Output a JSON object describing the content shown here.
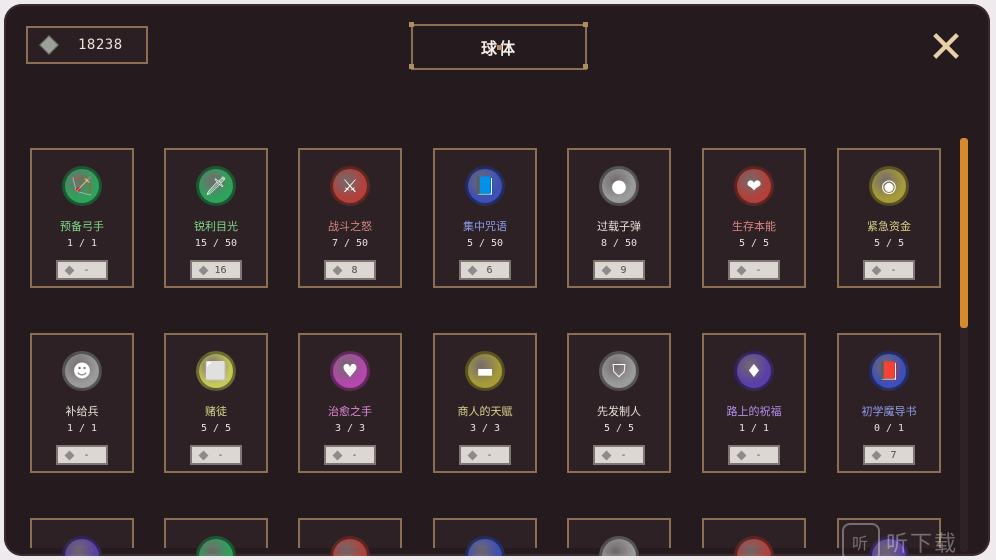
{
  "currency": {
    "icon": "gem-icon",
    "amount": "18238"
  },
  "title": "球体",
  "close_icon": "close-x-icon",
  "cards": [
    {
      "name": "预备弓手",
      "count": "1 / 1",
      "cost": "-",
      "name_color": "#7fd98a",
      "orb_color": "#2fa35c",
      "icon": "bow-icon",
      "glyph": "🏹"
    },
    {
      "name": "锐利目光",
      "count": "15 / 50",
      "cost": "16",
      "name_color": "#7fd98a",
      "orb_color": "#2fa35c",
      "icon": "sword-icon",
      "glyph": "🗡"
    },
    {
      "name": "战斗之怒",
      "count": "7 / 50",
      "cost": "8",
      "name_color": "#d9897f",
      "orb_color": "#b3403a",
      "icon": "sword-icon",
      "glyph": "⚔"
    },
    {
      "name": "集中咒语",
      "count": "5 / 50",
      "cost": "6",
      "name_color": "#8f9bea",
      "orb_color": "#3d4fb8",
      "icon": "tome-icon",
      "glyph": "📘"
    },
    {
      "name": "过载子弹",
      "count": "8 / 50",
      "cost": "9",
      "name_color": "#e6e0da",
      "orb_color": "#9b9b9b",
      "icon": "bullets-icon",
      "glyph": "●"
    },
    {
      "name": "生存本能",
      "count": "5 / 5",
      "cost": "-",
      "name_color": "#d9897f",
      "orb_color": "#b3403a",
      "icon": "heart-icon",
      "glyph": "❤"
    },
    {
      "name": "紧急资金",
      "count": "5 / 5",
      "cost": "-",
      "name_color": "#d9d08a",
      "orb_color": "#a79a3a",
      "icon": "coin-icon",
      "glyph": "◉"
    },
    {
      "name": "补给兵",
      "count": "1 / 1",
      "cost": "-",
      "name_color": "#e6e0da",
      "orb_color": "#9b9b9b",
      "icon": "soldier-icon",
      "glyph": "☻"
    },
    {
      "name": "赌徒",
      "count": "5 / 5",
      "cost": "-",
      "name_color": "#d9d98a",
      "orb_color": "#c7c75a",
      "icon": "dice-icon",
      "glyph": "⬜"
    },
    {
      "name": "治愈之手",
      "count": "3 / 3",
      "cost": "-",
      "name_color": "#e089d9",
      "orb_color": "#b547ad",
      "icon": "heart-hand-icon",
      "glyph": "♥"
    },
    {
      "name": "商人的天赋",
      "count": "3 / 3",
      "cost": "-",
      "name_color": "#d9d08a",
      "orb_color": "#a79a3a",
      "icon": "gold-bar-icon",
      "glyph": "▬"
    },
    {
      "name": "先发制人",
      "count": "5 / 5",
      "cost": "-",
      "name_color": "#e6e0da",
      "orb_color": "#9b9b9b",
      "icon": "shield-icon",
      "glyph": "⛉"
    },
    {
      "name": "路上的祝福",
      "count": "1 / 1",
      "cost": "-",
      "name_color": "#b48fea",
      "orb_color": "#5a3fa8",
      "icon": "crystal-icon",
      "glyph": "♦"
    },
    {
      "name": "初学魔导书",
      "count": "0 / 1",
      "cost": "7",
      "name_color": "#8f9bea",
      "orb_color": "#3d4fb8",
      "icon": "spellbook-icon",
      "glyph": "📕"
    }
  ],
  "partial_row_orb_colors": [
    "#5a3fa8",
    "#2fa35c",
    "#b3403a",
    "#3d4fb8",
    "#9b9b9b",
    "#b3403a",
    "#5a3fa8"
  ],
  "watermark": {
    "text": "听下载"
  },
  "colors": {
    "background": "#251a1d",
    "border": "#8a6f55",
    "scroll_thumb": "#d48b2e"
  }
}
